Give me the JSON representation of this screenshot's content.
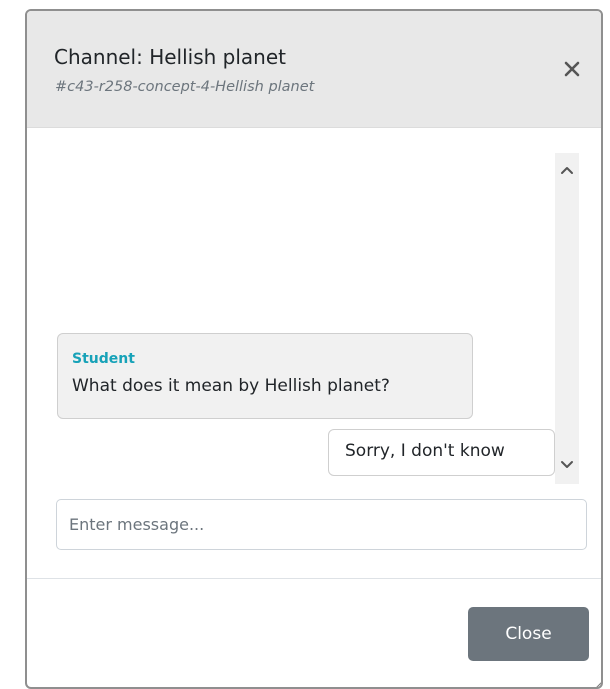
{
  "dialog": {
    "title": "Channel: Hellish planet",
    "subtitle": "#c43-r258-concept-4-Hellish planet",
    "close_icon": "close-icon"
  },
  "chat": {
    "messages": [
      {
        "sender": "Student",
        "text": "What does it mean by Hellish planet?"
      },
      {
        "sender": "",
        "text": "Sorry, I don't know"
      }
    ],
    "scroll_up_icon": "chevron-up-icon",
    "scroll_down_icon": "chevron-down-icon"
  },
  "composer": {
    "placeholder": "Enter message..."
  },
  "footer": {
    "close_label": "Close"
  },
  "colors": {
    "header_bg": "#e8e8e8",
    "sender_accent": "#17a2b8",
    "close_button_bg": "#6c757d"
  }
}
